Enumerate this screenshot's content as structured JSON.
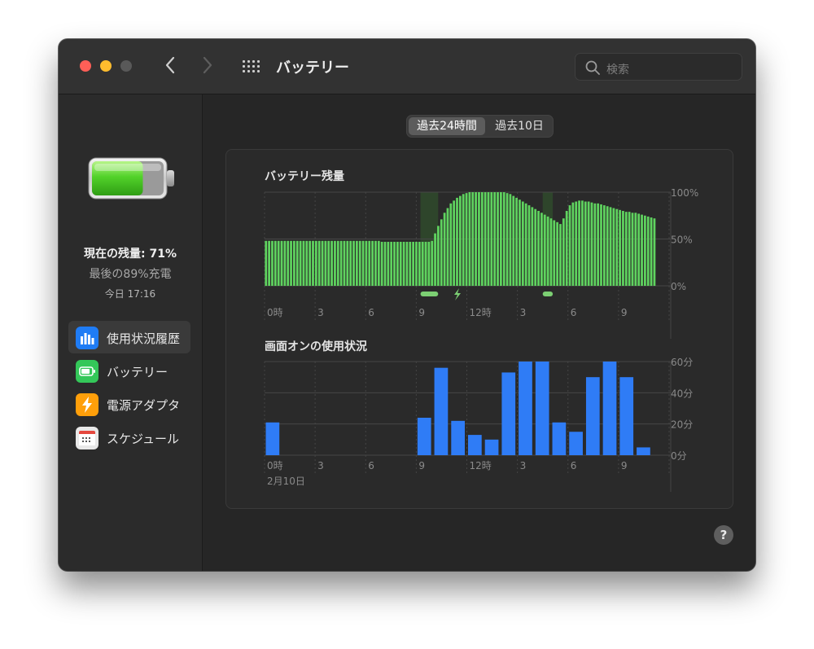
{
  "window": {
    "title": "バッテリー"
  },
  "search": {
    "placeholder": "検索"
  },
  "sidebar": {
    "battery_level_value": 0.71,
    "current_level": "現在の残量: 71%",
    "last_charge": "最後の89%充電",
    "last_charge_time": "今日 17:16",
    "items": [
      {
        "label": "使用状況履歴",
        "icon": "bar-chart-icon",
        "color": "#1f7cf5"
      },
      {
        "label": "バッテリー",
        "icon": "battery-icon",
        "color": "#34c759"
      },
      {
        "label": "電源アダプタ",
        "icon": "lightning-icon",
        "color": "#ff9f0a"
      },
      {
        "label": "スケジュール",
        "icon": "calendar-icon",
        "color": "#e8e8e8"
      }
    ]
  },
  "segments": {
    "selected": "過去24時間",
    "options": [
      "過去24時間",
      "過去10日"
    ]
  },
  "chart_data": [
    {
      "type": "bar",
      "title": "バッテリー残量",
      "color": "#5fd35f",
      "ylim": [
        0,
        100
      ],
      "yticks": [
        "100%",
        "50%",
        "0%"
      ],
      "xticks": [
        "0時",
        "3",
        "6",
        "9",
        "12時",
        "3",
        "6",
        "9"
      ],
      "charging_periods": [
        [
          9.25,
          10.3
        ],
        [
          16.5,
          17.1
        ]
      ],
      "values": [
        48,
        48,
        48,
        48,
        48,
        48,
        48,
        48,
        48,
        48,
        48,
        48,
        48,
        48,
        48,
        48,
        48,
        48,
        48,
        48,
        48,
        48,
        48,
        48,
        48,
        48,
        48,
        48,
        48,
        48,
        48,
        48,
        48,
        48,
        48,
        48,
        48,
        47,
        47,
        47,
        47,
        47,
        47,
        47,
        47,
        47,
        47,
        47,
        47,
        47,
        47,
        47,
        47,
        48,
        56,
        64,
        71,
        78,
        83,
        88,
        91,
        94,
        96,
        98,
        99,
        100,
        100,
        100,
        100,
        100,
        100,
        100,
        100,
        100,
        100,
        100,
        100,
        99,
        98,
        96,
        94,
        92,
        90,
        88,
        86,
        84,
        82,
        80,
        78,
        76,
        74,
        72,
        70,
        68,
        66,
        72,
        80,
        86,
        89,
        90,
        91,
        91,
        90,
        90,
        89,
        88,
        88,
        87,
        86,
        85,
        84,
        83,
        82,
        81,
        80,
        79,
        79,
        78,
        78,
        77,
        76,
        75,
        74,
        73,
        72
      ]
    },
    {
      "type": "bar",
      "title": "画面オンの使用状況",
      "color": "#2f7cf6",
      "ylim": [
        0,
        60
      ],
      "yticks": [
        "60分",
        "40分",
        "20分",
        "0分"
      ],
      "xticks": [
        "0時",
        "3",
        "6",
        "9",
        "12時",
        "3",
        "6",
        "9"
      ],
      "date_label": "2月10日",
      "values": [
        21,
        0,
        0,
        0,
        0,
        0,
        0,
        0,
        0,
        24,
        56,
        22,
        13,
        10,
        53,
        60,
        60,
        21,
        15,
        50,
        60,
        50,
        5
      ]
    }
  ]
}
